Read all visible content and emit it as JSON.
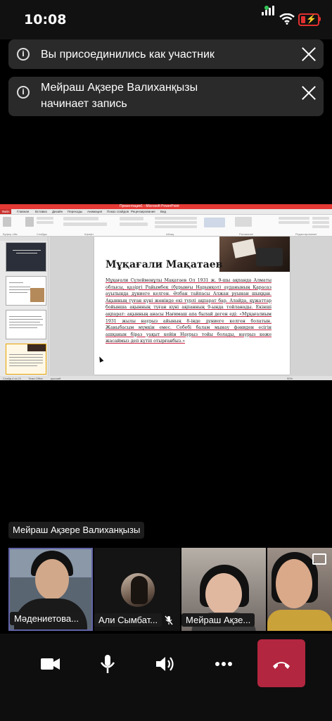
{
  "status_bar": {
    "time": "10:08"
  },
  "notifications": [
    {
      "message": "Вы присоединились как участник"
    },
    {
      "message": "Мейраш Ақзере Валиханқызы начинает запись"
    }
  ],
  "shared_screen": {
    "app_title": "Презентация1 - Microsoft PowerPoint",
    "ribbon_tabs": [
      "Файл",
      "Главная",
      "Вставка",
      "Дизайн",
      "Переходы",
      "Анимация",
      "Показ слайдов",
      "Рецензирование",
      "Вид"
    ],
    "ribbon_groups": [
      "Буфер обм",
      "Слайды",
      "Шрифт",
      "Абзац",
      "Рисование",
      "Редактирование"
    ],
    "slide": {
      "title": "Мұқағали Мақатаев",
      "body": "Мұқағали Сүлейменұлы Мақатаев Ол 1931 ж. 9-шы ақпанда Алматы облысы, қазіргі Райымбек (бұрынғы Нарынқол) ауданының Қарасаз ауылында дүниеге келген. Әлбан тайпасы Алжан руынан шыққан. Ақынның туған күні жөнінде екі түрлі ақпарат бар. Алайда, құжаттар бойынша ақынның туған күні ақпанның 9-ында тойланады. Екінші ақпарат: ақынның анасы Нағимаш апа былай деген еді: «Мұқағалиым 1931 жылы наурыз айының 8-інде дүниеге келген болатын. Жаныбасым мүмкін емес. Себебі балам мынау фәниден есігін ашқанын біраз уақыт кейін Наурыз тойы болады, наурыз көже жасаймыз деп күтіп отырғанбыз.»"
    },
    "status_left": "Слайд 4 из 21",
    "status_theme": "Тема Office",
    "status_lang": "русский",
    "status_zoom": "90%"
  },
  "speaker_label": "Мейраш Ақзере Валиханқызы",
  "participants": [
    {
      "name": "Мәдениетова...",
      "active": true
    },
    {
      "name": "Али Сымбат...",
      "muted": true
    },
    {
      "name": "Мейраш Ақзе..."
    },
    {
      "name": ""
    }
  ],
  "controls": {
    "icons": [
      "video-icon",
      "microphone-icon",
      "speaker-icon",
      "more-icon",
      "hangup-icon"
    ],
    "hangup_color": "#b3263f"
  }
}
